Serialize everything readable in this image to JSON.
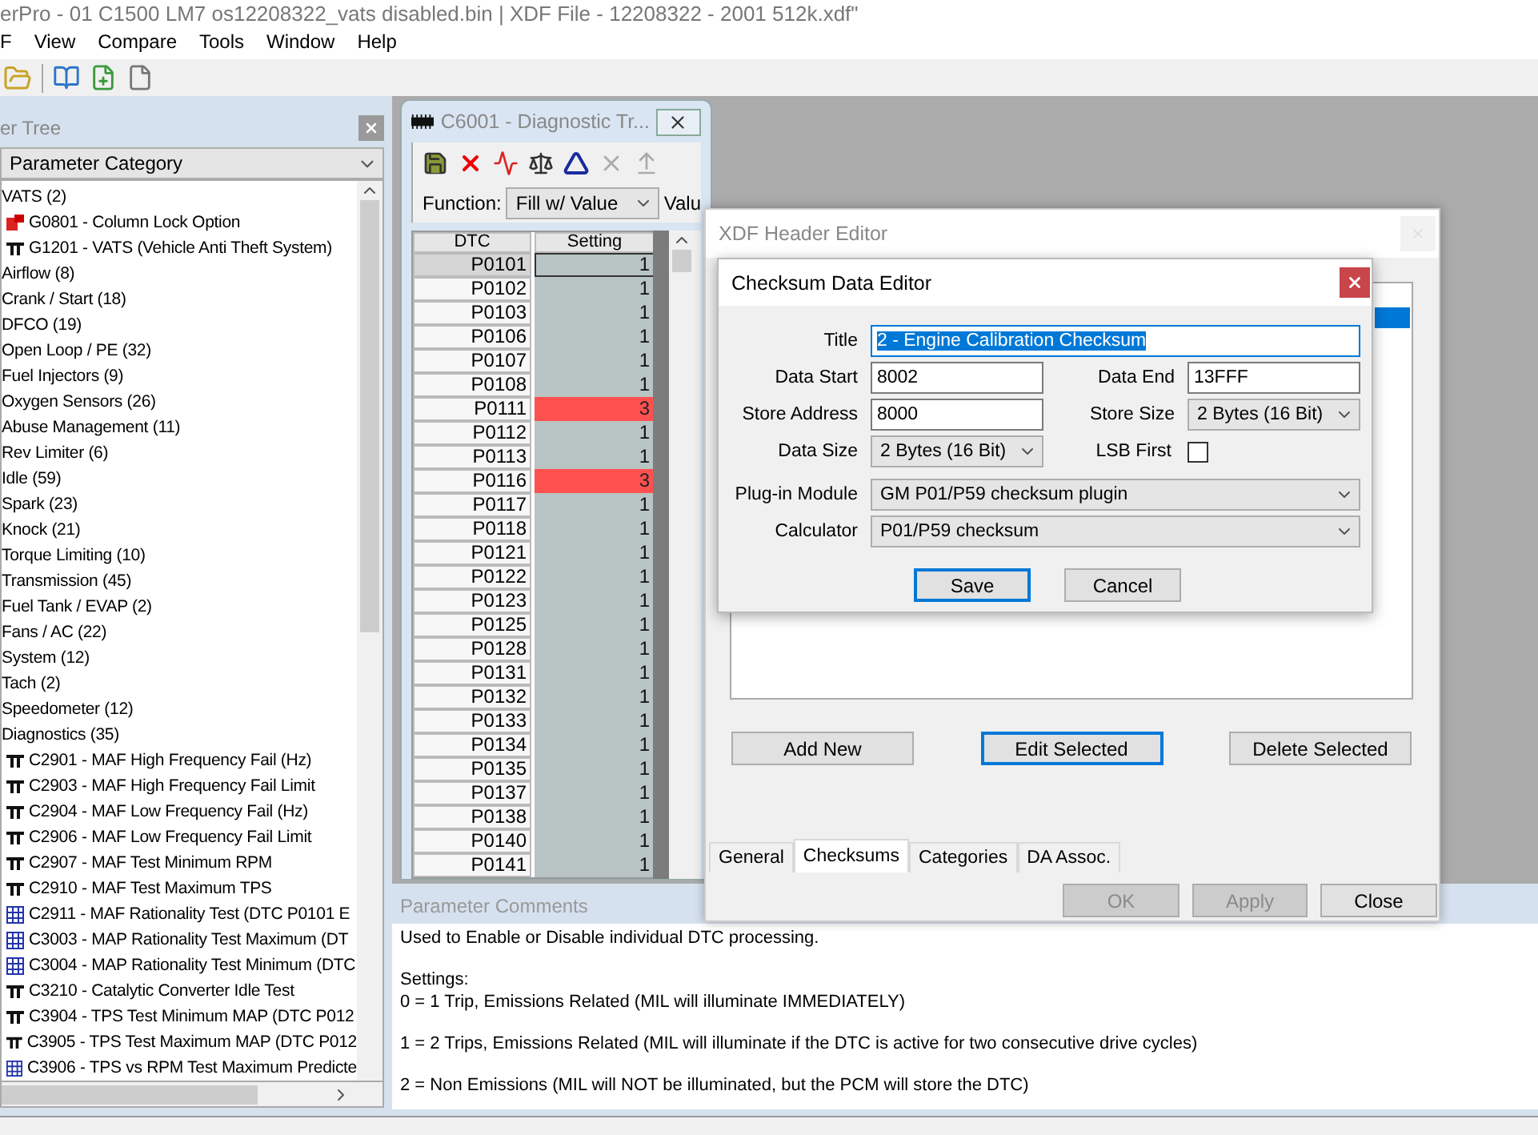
{
  "window": {
    "title": "erPro -  01 C1500 LM7 os12208322_vats disabled.bin | XDF File - 12208322 - 2001 512k.xdf\""
  },
  "menu": [
    "F",
    "View",
    "Compare",
    "Tools",
    "Window",
    "Help"
  ],
  "tree_panel": {
    "title": "er Tree",
    "view": "Parameter Category",
    "items": [
      {
        "label": "VATS (2)",
        "children": [
          {
            "label": "G0801 - Column Lock Option",
            "kind": "flag"
          },
          {
            "label": "G1201 - VATS (Vehicle Anti Theft System)",
            "kind": "constant"
          }
        ]
      },
      {
        "label": "Airflow (8)"
      },
      {
        "label": "Crank / Start (18)"
      },
      {
        "label": "DFCO (19)"
      },
      {
        "label": "Open Loop / PE (32)"
      },
      {
        "label": "Fuel Injectors (9)"
      },
      {
        "label": "Oxygen Sensors (26)"
      },
      {
        "label": "Abuse Management (11)"
      },
      {
        "label": "Rev Limiter (6)"
      },
      {
        "label": "Idle (59)"
      },
      {
        "label": "Spark (23)"
      },
      {
        "label": "Knock (21)"
      },
      {
        "label": "Torque Limiting (10)"
      },
      {
        "label": "Transmission (45)"
      },
      {
        "label": "Fuel Tank / EVAP (2)"
      },
      {
        "label": "Fans / AC (22)"
      },
      {
        "label": "System (12)"
      },
      {
        "label": "Tach (2)"
      },
      {
        "label": "Speedometer (12)"
      },
      {
        "label": "Diagnostics (35)",
        "children": [
          {
            "label": "C2901 - MAF High Frequency Fail (Hz)",
            "kind": "constant"
          },
          {
            "label": "C2903 - MAF High Frequency Fail Limit",
            "kind": "constant"
          },
          {
            "label": "C2904 - MAF Low Frequency Fail (Hz)",
            "kind": "constant"
          },
          {
            "label": "C2906 - MAF Low Frequency Fail Limit",
            "kind": "constant"
          },
          {
            "label": "C2907 - MAF Test Minimum RPM",
            "kind": "constant"
          },
          {
            "label": "C2910 - MAF Test Maximum TPS",
            "kind": "constant"
          },
          {
            "label": "C2911 - MAF Rationality Test (DTC P0101 E",
            "kind": "table"
          },
          {
            "label": "C3003 - MAP Rationality Test Maximum (DT",
            "kind": "table"
          },
          {
            "label": "C3004 - MAP Rationality Test Minimum (DTC",
            "kind": "table"
          },
          {
            "label": "C3210 - Catalytic Converter Idle Test",
            "kind": "constant"
          },
          {
            "label": "C3904 - TPS Test Minimum MAP (DTC P012",
            "kind": "constant"
          },
          {
            "label": "C3905 - TPS Test Maximum MAP (DTC P012",
            "kind": "constant"
          },
          {
            "label": "C3906 - TPS vs RPM Test Maximum Predicte",
            "kind": "table"
          }
        ]
      }
    ]
  },
  "dtc_window": {
    "title": "C6001 - Diagnostic Tr...",
    "function_label": "Function:",
    "function": "Fill w/ Value",
    "value_label": "Valu",
    "columns": [
      "DTC",
      "Setting"
    ],
    "rows": [
      {
        "dtc": "P0101",
        "setting": "1",
        "selected": true,
        "highlighted": false
      },
      {
        "dtc": "P0102",
        "setting": "1",
        "selected": false,
        "highlighted": false
      },
      {
        "dtc": "P0103",
        "setting": "1",
        "selected": false,
        "highlighted": false
      },
      {
        "dtc": "P0106",
        "setting": "1",
        "selected": false,
        "highlighted": false
      },
      {
        "dtc": "P0107",
        "setting": "1",
        "selected": false,
        "highlighted": false
      },
      {
        "dtc": "P0108",
        "setting": "1",
        "selected": false,
        "highlighted": false
      },
      {
        "dtc": "P0111",
        "setting": "3",
        "selected": false,
        "highlighted": true
      },
      {
        "dtc": "P0112",
        "setting": "1",
        "selected": false,
        "highlighted": false
      },
      {
        "dtc": "P0113",
        "setting": "1",
        "selected": false,
        "highlighted": false
      },
      {
        "dtc": "P0116",
        "setting": "3",
        "selected": false,
        "highlighted": true
      },
      {
        "dtc": "P0117",
        "setting": "1",
        "selected": false,
        "highlighted": false
      },
      {
        "dtc": "P0118",
        "setting": "1",
        "selected": false,
        "highlighted": false
      },
      {
        "dtc": "P0121",
        "setting": "1",
        "selected": false,
        "highlighted": false
      },
      {
        "dtc": "P0122",
        "setting": "1",
        "selected": false,
        "highlighted": false
      },
      {
        "dtc": "P0123",
        "setting": "1",
        "selected": false,
        "highlighted": false
      },
      {
        "dtc": "P0125",
        "setting": "1",
        "selected": false,
        "highlighted": false
      },
      {
        "dtc": "P0128",
        "setting": "1",
        "selected": false,
        "highlighted": false
      },
      {
        "dtc": "P0131",
        "setting": "1",
        "selected": false,
        "highlighted": false
      },
      {
        "dtc": "P0132",
        "setting": "1",
        "selected": false,
        "highlighted": false
      },
      {
        "dtc": "P0133",
        "setting": "1",
        "selected": false,
        "highlighted": false
      },
      {
        "dtc": "P0134",
        "setting": "1",
        "selected": false,
        "highlighted": false
      },
      {
        "dtc": "P0135",
        "setting": "1",
        "selected": false,
        "highlighted": false
      },
      {
        "dtc": "P0137",
        "setting": "1",
        "selected": false,
        "highlighted": false
      },
      {
        "dtc": "P0138",
        "setting": "1",
        "selected": false,
        "highlighted": false
      },
      {
        "dtc": "P0140",
        "setting": "1",
        "selected": false,
        "highlighted": false
      },
      {
        "dtc": "P0141",
        "setting": "1",
        "selected": false,
        "highlighted": false
      }
    ]
  },
  "comments": {
    "title": "Parameter Comments",
    "paragraphs": [
      [
        "Used to Enable or Disable individual DTC processing."
      ],
      [
        "Settings:",
        "0 = 1 Trip, Emissions Related (MIL will illuminate IMMEDIATELY)"
      ],
      [
        "1 = 2 Trips, Emissions Related (MIL will illuminate if the DTC is active for two consecutive drive cycles)"
      ],
      [
        "2 = Non Emissions (MIL will NOT be illuminated, but the PCM will store the DTC)"
      ]
    ]
  },
  "header_editor": {
    "title": "XDF Header Editor",
    "buttons": [
      {
        "label": "Add New",
        "default": false
      },
      {
        "label": "Edit Selected",
        "default": true
      },
      {
        "label": "Delete Selected",
        "default": false
      }
    ],
    "tabs": [
      {
        "label": "General",
        "selected": false
      },
      {
        "label": "Checksums",
        "selected": true
      },
      {
        "label": "Categories",
        "selected": false
      },
      {
        "label": "DA Assoc.",
        "selected": false
      }
    ],
    "footer_buttons": [
      {
        "label": "OK",
        "disabled": true
      },
      {
        "label": "Apply",
        "disabled": true
      },
      {
        "label": "Close",
        "disabled": false
      }
    ]
  },
  "checksum_editor": {
    "title": "Checksum Data Editor",
    "title_field": {
      "label": "Title",
      "value": "2 - Engine Calibration Checksum",
      "text_selected": true
    },
    "data_start": {
      "label": "Data Start",
      "value": "8002"
    },
    "data_end": {
      "label": "Data End",
      "value": "13FFF"
    },
    "store_address": {
      "label": "Store Address",
      "value": "8000"
    },
    "store_size": {
      "label": "Store Size",
      "value": "2 Bytes (16 Bit)"
    },
    "data_size": {
      "label": "Data Size",
      "value": "2 Bytes (16 Bit)"
    },
    "lsb_first": {
      "label": "LSB First",
      "checked": false
    },
    "plugin_module": {
      "label": "Plug-in Module",
      "value": "GM P01/P59 checksum plugin"
    },
    "calculator": {
      "label": "Calculator",
      "value": "P01/P59 checksum"
    },
    "buttons": [
      {
        "label": "Save",
        "default": true
      },
      {
        "label": "Cancel",
        "default": false
      }
    ]
  }
}
